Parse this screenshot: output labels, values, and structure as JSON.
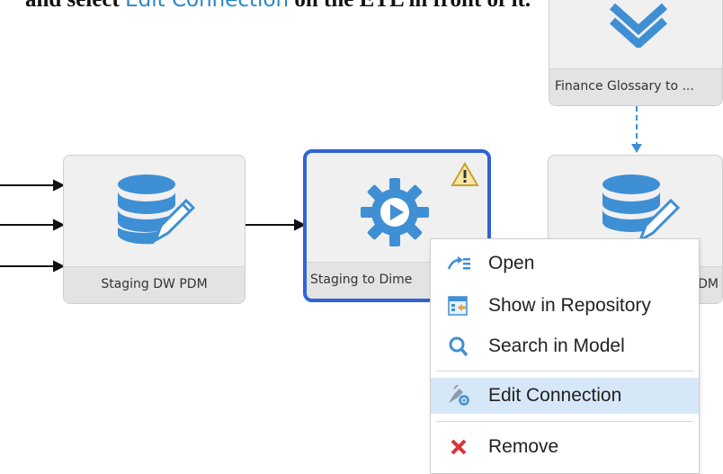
{
  "doc": {
    "text_before": "and select ",
    "text_accent": "Edit Connection",
    "text_after": " on the ETL in front of it."
  },
  "nodes": [
    {
      "label": "Finance Glossary to ...",
      "icon": "chevron-down-double-icon"
    },
    {
      "label": "Staging DW PDM",
      "icon": "database-edit-icon"
    },
    {
      "label": "Staging to Dime",
      "icon": "etl-gear-play-icon",
      "selected": true,
      "warning": true
    },
    {
      "label": "DM",
      "icon": "database-edit-icon"
    }
  ],
  "context_menu": {
    "items": [
      {
        "label": "Open",
        "icon": "open-icon"
      },
      {
        "label": "Show in Repository",
        "icon": "repository-icon"
      },
      {
        "label": "Search in Model",
        "icon": "search-icon"
      },
      {
        "label": "Edit Connection",
        "icon": "edit-connection-icon",
        "highlighted": true
      },
      {
        "label": "Remove",
        "icon": "remove-icon"
      }
    ]
  },
  "colors": {
    "icon_blue": "#3f8fd4",
    "selection_border": "#2f63d6",
    "menu_highlight": "#d6e8f8",
    "remove_red": "#d9343a",
    "warning_yellow": "#f2c43d"
  }
}
